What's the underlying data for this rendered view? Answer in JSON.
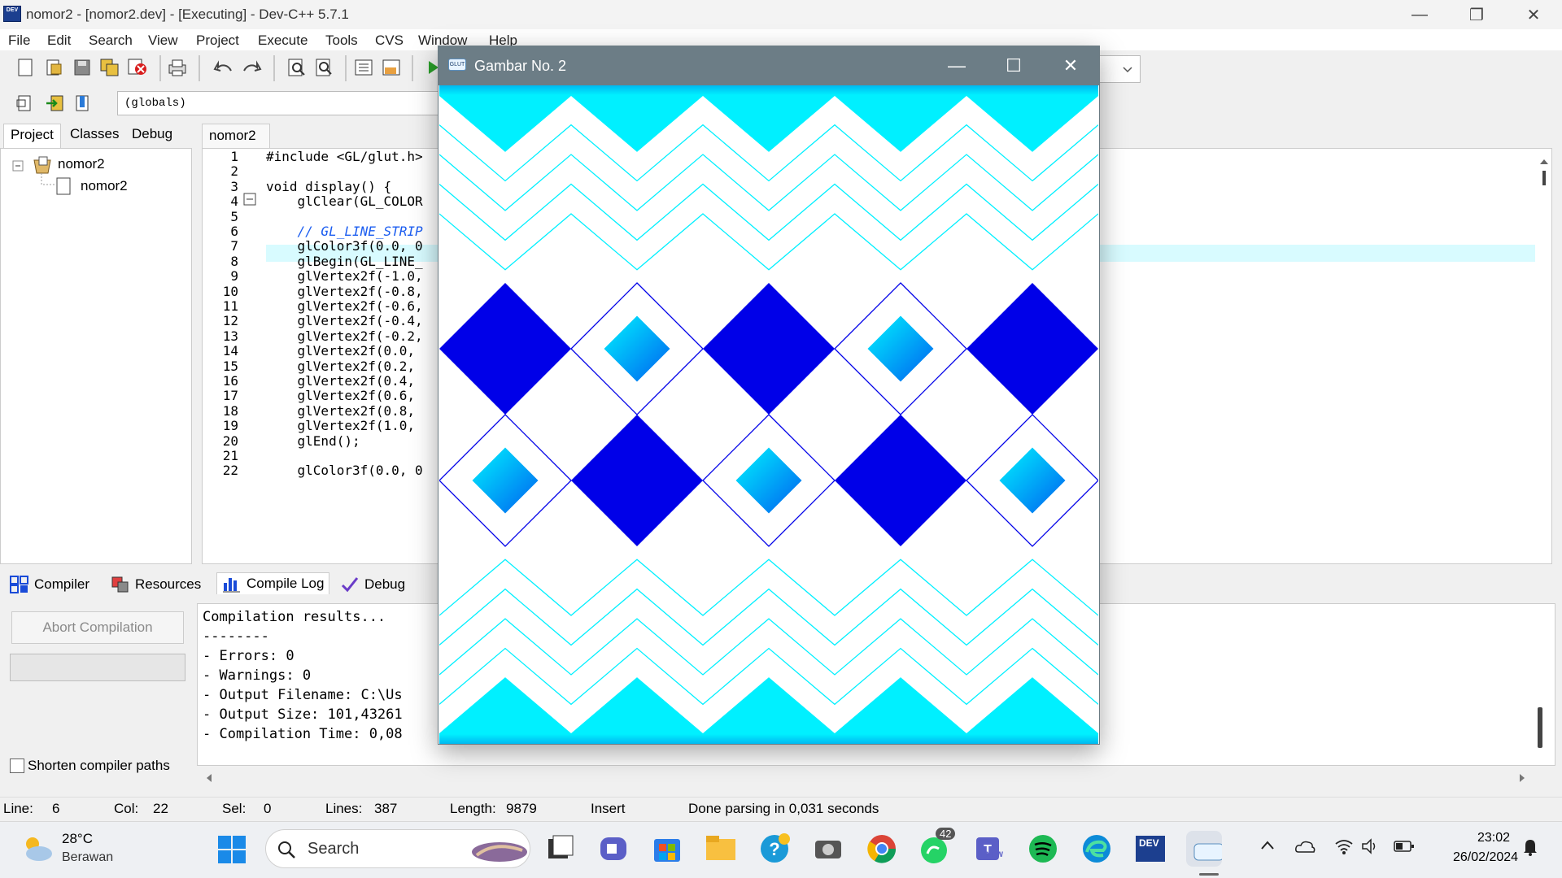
{
  "window": {
    "title": "nomor2 - [nomor2.dev] - [Executing] - Dev-C++ 5.7.1",
    "icon_text": "DEV"
  },
  "menu": [
    "File",
    "Edit",
    "Search",
    "View",
    "Project",
    "Execute",
    "Tools",
    "CVS",
    "Window",
    "Help"
  ],
  "toolbar2": {
    "scope_value": "(globals)"
  },
  "left_panel": {
    "tabs": [
      "Project",
      "Classes",
      "Debug"
    ],
    "tree": {
      "project": "nomor2",
      "file": "nomor2"
    }
  },
  "editor": {
    "tab": "nomor2",
    "lines": [
      {
        "n": "1",
        "code": "#include <GL/glut.h>"
      },
      {
        "n": "2",
        "code": ""
      },
      {
        "n": "3",
        "code": "void display() {"
      },
      {
        "n": "4",
        "code": "    glClear(GL_COLOR"
      },
      {
        "n": "5",
        "code": ""
      },
      {
        "n": "6",
        "code": "    // GL_LINE_STRIP"
      },
      {
        "n": "7",
        "code": "    glColor3f(0.0, 0"
      },
      {
        "n": "8",
        "code": "    glBegin(GL_LINE_"
      },
      {
        "n": "9",
        "code": "    glVertex2f(-1.0,"
      },
      {
        "n": "10",
        "code": "    glVertex2f(-0.8,"
      },
      {
        "n": "11",
        "code": "    glVertex2f(-0.6,"
      },
      {
        "n": "12",
        "code": "    glVertex2f(-0.4,"
      },
      {
        "n": "13",
        "code": "    glVertex2f(-0.2,"
      },
      {
        "n": "14",
        "code": "    glVertex2f(0.0,"
      },
      {
        "n": "15",
        "code": "    glVertex2f(0.2,"
      },
      {
        "n": "16",
        "code": "    glVertex2f(0.4,"
      },
      {
        "n": "17",
        "code": "    glVertex2f(0.6,"
      },
      {
        "n": "18",
        "code": "    glVertex2f(0.8,"
      },
      {
        "n": "19",
        "code": "    glVertex2f(1.0,"
      },
      {
        "n": "20",
        "code": "    glEnd();"
      },
      {
        "n": "21",
        "code": ""
      },
      {
        "n": "22",
        "code": "    glColor3f(0.0, 0"
      }
    ]
  },
  "bottom_panel": {
    "tabs": [
      "Compiler",
      "Resources",
      "Compile Log",
      "Debug"
    ],
    "abort_label": "Abort Compilation",
    "shorten_label": "Shorten compiler paths",
    "log": [
      "Compilation results...",
      "--------",
      "- Errors: 0",
      "- Warnings: 0",
      "- Output Filename: C:\\Us",
      "- Output Size: 101,43261",
      "- Compilation Time: 0,08"
    ]
  },
  "statusbar": {
    "line_label": "Line:",
    "line_value": "6",
    "col_label": "Col:",
    "col_value": "22",
    "sel_label": "Sel:",
    "sel_value": "0",
    "lines_label": "Lines:",
    "lines_value": "387",
    "length_label": "Length:",
    "length_value": "9879",
    "mode": "Insert",
    "message": "Done parsing in 0,031 seconds"
  },
  "gl_window": {
    "title": "Gambar No. 2",
    "icon_text": "GLUT"
  },
  "colors": {
    "cyan": "#00f0ff",
    "blue": "#0000e8",
    "glass_title": "#6c7d86"
  },
  "taskbar": {
    "weather_temp": "28°C",
    "weather_desc": "Berawan",
    "search_label": "Search",
    "whatsapp_badge": "42",
    "teams_label": "NEW",
    "devcpp_label": "DEV",
    "time": "23:02",
    "date": "26/02/2024"
  }
}
